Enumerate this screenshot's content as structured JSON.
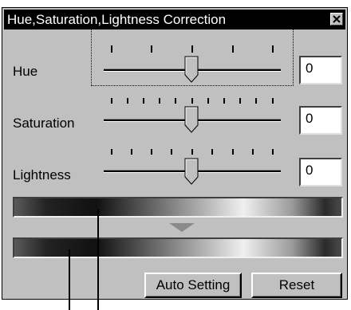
{
  "dialog": {
    "title": "Hue,Saturation,Lightness Correction",
    "close_glyph": "×"
  },
  "sliders": [
    {
      "label": "Hue",
      "value": "0",
      "level": 0.5
    },
    {
      "label": "Saturation",
      "value": "0",
      "level": 0.5
    },
    {
      "label": "Lightness",
      "value": "0",
      "level": 0.5
    }
  ],
  "buttons": {
    "auto_setting": "Auto Setting",
    "reset": "Reset"
  },
  "icons": [
    "close-icon",
    "slider-thumb-icon",
    "down-arrow-icon"
  ]
}
